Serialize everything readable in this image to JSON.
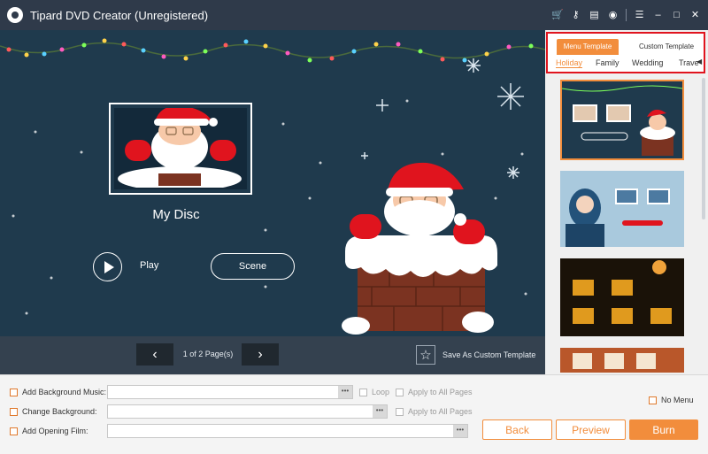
{
  "window": {
    "title": "Tipard DVD Creator (Unregistered)"
  },
  "toolbar": {
    "icons": [
      "cart-icon",
      "key-icon",
      "save-icon",
      "chat-icon",
      "menu-icon",
      "minimize-icon",
      "maximize-icon",
      "close-icon"
    ]
  },
  "preview": {
    "disc_title": "My Disc",
    "play_label": "Play",
    "scene_label": "Scene",
    "page_indicator": "1 of 2 Page(s)",
    "save_template_label": "Save As Custom Template"
  },
  "templates": {
    "tabs": [
      "Menu Template",
      "Custom Template"
    ],
    "active_tab": "Menu Template",
    "categories": [
      "Holiday",
      "Family",
      "Wedding",
      "Trave"
    ],
    "active_category": "Holiday"
  },
  "bottom": {
    "add_background_music": "Add Background Music:",
    "change_background": "Change Background:",
    "add_opening_film": "Add Opening Film:",
    "browse": "•••",
    "loop": "Loop",
    "apply_all_1": "Apply to All Pages",
    "apply_all_2": "Apply to All Pages",
    "no_menu": "No Menu",
    "back": "Back",
    "preview": "Preview",
    "burn": "Burn"
  },
  "colors": {
    "accent": "#f28d3c",
    "titlebar": "#2f3a4a",
    "preview_bg": "#1f3a4d",
    "highlight": "#e0141e"
  }
}
